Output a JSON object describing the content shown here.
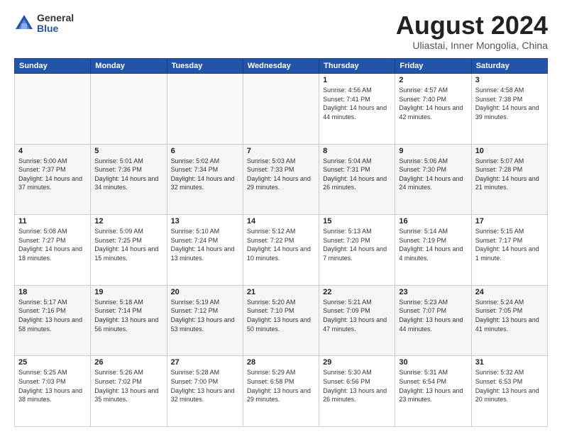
{
  "logo": {
    "general": "General",
    "blue": "Blue"
  },
  "title": {
    "month_year": "August 2024",
    "location": "Uliastai, Inner Mongolia, China"
  },
  "weekdays": [
    "Sunday",
    "Monday",
    "Tuesday",
    "Wednesday",
    "Thursday",
    "Friday",
    "Saturday"
  ],
  "weeks": [
    [
      {
        "day": "",
        "info": ""
      },
      {
        "day": "",
        "info": ""
      },
      {
        "day": "",
        "info": ""
      },
      {
        "day": "",
        "info": ""
      },
      {
        "day": "1",
        "info": "Sunrise: 4:56 AM\nSunset: 7:41 PM\nDaylight: 14 hours\nand 44 minutes."
      },
      {
        "day": "2",
        "info": "Sunrise: 4:57 AM\nSunset: 7:40 PM\nDaylight: 14 hours\nand 42 minutes."
      },
      {
        "day": "3",
        "info": "Sunrise: 4:58 AM\nSunset: 7:38 PM\nDaylight: 14 hours\nand 39 minutes."
      }
    ],
    [
      {
        "day": "4",
        "info": "Sunrise: 5:00 AM\nSunset: 7:37 PM\nDaylight: 14 hours\nand 37 minutes."
      },
      {
        "day": "5",
        "info": "Sunrise: 5:01 AM\nSunset: 7:36 PM\nDaylight: 14 hours\nand 34 minutes."
      },
      {
        "day": "6",
        "info": "Sunrise: 5:02 AM\nSunset: 7:34 PM\nDaylight: 14 hours\nand 32 minutes."
      },
      {
        "day": "7",
        "info": "Sunrise: 5:03 AM\nSunset: 7:33 PM\nDaylight: 14 hours\nand 29 minutes."
      },
      {
        "day": "8",
        "info": "Sunrise: 5:04 AM\nSunset: 7:31 PM\nDaylight: 14 hours\nand 26 minutes."
      },
      {
        "day": "9",
        "info": "Sunrise: 5:06 AM\nSunset: 7:30 PM\nDaylight: 14 hours\nand 24 minutes."
      },
      {
        "day": "10",
        "info": "Sunrise: 5:07 AM\nSunset: 7:28 PM\nDaylight: 14 hours\nand 21 minutes."
      }
    ],
    [
      {
        "day": "11",
        "info": "Sunrise: 5:08 AM\nSunset: 7:27 PM\nDaylight: 14 hours\nand 18 minutes."
      },
      {
        "day": "12",
        "info": "Sunrise: 5:09 AM\nSunset: 7:25 PM\nDaylight: 14 hours\nand 15 minutes."
      },
      {
        "day": "13",
        "info": "Sunrise: 5:10 AM\nSunset: 7:24 PM\nDaylight: 14 hours\nand 13 minutes."
      },
      {
        "day": "14",
        "info": "Sunrise: 5:12 AM\nSunset: 7:22 PM\nDaylight: 14 hours\nand 10 minutes."
      },
      {
        "day": "15",
        "info": "Sunrise: 5:13 AM\nSunset: 7:20 PM\nDaylight: 14 hours\nand 7 minutes."
      },
      {
        "day": "16",
        "info": "Sunrise: 5:14 AM\nSunset: 7:19 PM\nDaylight: 14 hours\nand 4 minutes."
      },
      {
        "day": "17",
        "info": "Sunrise: 5:15 AM\nSunset: 7:17 PM\nDaylight: 14 hours\nand 1 minute."
      }
    ],
    [
      {
        "day": "18",
        "info": "Sunrise: 5:17 AM\nSunset: 7:16 PM\nDaylight: 13 hours\nand 58 minutes."
      },
      {
        "day": "19",
        "info": "Sunrise: 5:18 AM\nSunset: 7:14 PM\nDaylight: 13 hours\nand 56 minutes."
      },
      {
        "day": "20",
        "info": "Sunrise: 5:19 AM\nSunset: 7:12 PM\nDaylight: 13 hours\nand 53 minutes."
      },
      {
        "day": "21",
        "info": "Sunrise: 5:20 AM\nSunset: 7:10 PM\nDaylight: 13 hours\nand 50 minutes."
      },
      {
        "day": "22",
        "info": "Sunrise: 5:21 AM\nSunset: 7:09 PM\nDaylight: 13 hours\nand 47 minutes."
      },
      {
        "day": "23",
        "info": "Sunrise: 5:23 AM\nSunset: 7:07 PM\nDaylight: 13 hours\nand 44 minutes."
      },
      {
        "day": "24",
        "info": "Sunrise: 5:24 AM\nSunset: 7:05 PM\nDaylight: 13 hours\nand 41 minutes."
      }
    ],
    [
      {
        "day": "25",
        "info": "Sunrise: 5:25 AM\nSunset: 7:03 PM\nDaylight: 13 hours\nand 38 minutes."
      },
      {
        "day": "26",
        "info": "Sunrise: 5:26 AM\nSunset: 7:02 PM\nDaylight: 13 hours\nand 35 minutes."
      },
      {
        "day": "27",
        "info": "Sunrise: 5:28 AM\nSunset: 7:00 PM\nDaylight: 13 hours\nand 32 minutes."
      },
      {
        "day": "28",
        "info": "Sunrise: 5:29 AM\nSunset: 6:58 PM\nDaylight: 13 hours\nand 29 minutes."
      },
      {
        "day": "29",
        "info": "Sunrise: 5:30 AM\nSunset: 6:56 PM\nDaylight: 13 hours\nand 26 minutes."
      },
      {
        "day": "30",
        "info": "Sunrise: 5:31 AM\nSunset: 6:54 PM\nDaylight: 13 hours\nand 23 minutes."
      },
      {
        "day": "31",
        "info": "Sunrise: 5:32 AM\nSunset: 6:53 PM\nDaylight: 13 hours\nand 20 minutes."
      }
    ]
  ]
}
